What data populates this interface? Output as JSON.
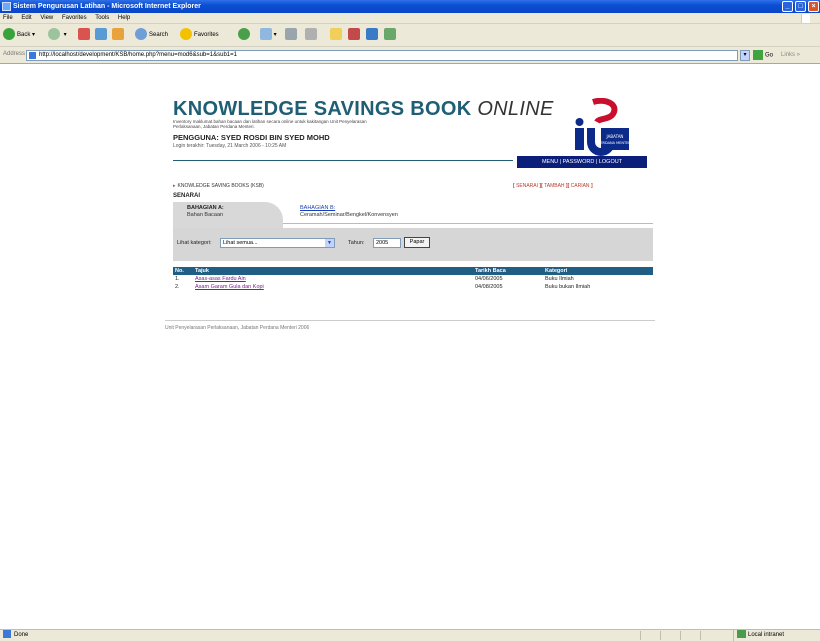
{
  "window": {
    "title": "Sistem Pengurusan Latihan - Microsoft Internet Explorer"
  },
  "menu": [
    "File",
    "Edit",
    "View",
    "Favorites",
    "Tools",
    "Help"
  ],
  "toolbar": {
    "back_label": "Back",
    "search_label": "Search",
    "favorites_label": "Favorites"
  },
  "address": {
    "label": "Address",
    "url": "http://localhost/development/KSB/home.php?menu=mod6&sub=1&sub1=1",
    "go_label": "Go",
    "links_label": "Links"
  },
  "status": {
    "text": "Done",
    "zone": "Local intranet"
  },
  "page": {
    "title_main": "KNOWLEDGE SAVINGS BOOK",
    "title_online": "ONLINE",
    "subtitle": "Inventory maklumat bahan bacaan dan latihan secara online untuk kakitangan Unit Penyelarasan Perlaksanaan, Jabatan Perdana Menteri.",
    "user": "PENGGUNA: SYED ROSDI BIN SYED MOHD",
    "login": "Login terakhir: Tuesday, 21 March 2006 - 10:25 AM",
    "nav": {
      "menu": "MENU",
      "password": "PASSWORD",
      "logout": "LOGOUT"
    },
    "logo": {
      "letters": "ICU",
      "caption1": "JABATAN",
      "caption2": "PERDANA MENTERI"
    },
    "breadcrumb": "KNOWLEDGE SAVING BOOKS (KSB)",
    "actions": {
      "senarai": "SENARAI",
      "tambah": "TAMBAH",
      "carian": "CARIAN"
    },
    "section": "SENARAI",
    "tab_a": {
      "title": "BAHAGIAN A:",
      "sub": "Bahan Bacaan"
    },
    "tab_b": {
      "title": "BAHAGIAN B:",
      "sub": "Ceramah/Seminar/Bengkel/Konvensyen"
    },
    "filter": {
      "category_label": "Lihat kategori:",
      "category_value": "Lihat semua...",
      "year_label": "Tahun:",
      "year_value": "2005",
      "button": "Papar"
    },
    "table": {
      "headers": [
        "No.",
        "Tajuk",
        "Tarikh Baca",
        "Kategori"
      ],
      "rows": [
        [
          "1.",
          "Asas-asas Fardu Ain",
          "04/06/2005",
          "Buku Ilmiah"
        ],
        [
          "2.",
          "Asam Garam Gula dan Kopi",
          "04/08/2005",
          "Buku bukan Ilmiah"
        ]
      ]
    },
    "footer": "Unit Penyelarasan Perlaksanaan, Jabatan Perdana Menteri 2006"
  }
}
